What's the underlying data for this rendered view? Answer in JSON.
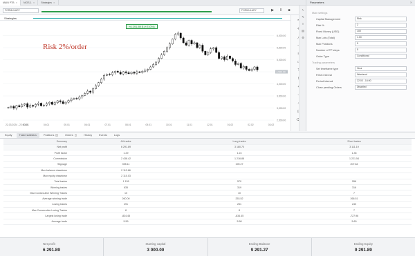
{
  "tabs": [
    {
      "label": "MAIN PTB",
      "active": true
    },
    {
      "label": "NIOS-1",
      "active": false
    },
    {
      "label": "Strategies",
      "active": false
    }
  ],
  "toolbar": {
    "strategy_select": "FORMULARY",
    "right_select": "FORMULARY",
    "progress": 1.0,
    "play_icon": "▶",
    "pause_icon": "‖",
    "stop_icon": "■"
  },
  "chart": {
    "header_label": "Strategies",
    "pnl_badge": "+6 291.89 $ (+210%)",
    "risk_label": "Risk 2%/order"
  },
  "chart_data": {
    "type": "candlestick",
    "x_ticks": [
      "22.03.2024 - 22:00:00",
      "03.01",
      "04.01",
      "05.01",
      "06.01",
      "07.01",
      "08.01",
      "09.01",
      "10.01",
      "11.01",
      "12.01",
      "01.02",
      "02.02",
      "03.02"
    ],
    "y_ticks": [
      "6,000.00",
      "5,500.00",
      "5,000.00",
      "4,500.00",
      "4,000.00",
      "3,500.00",
      "3,000.00",
      "2,500.00"
    ],
    "y_range": [
      2500,
      6500
    ],
    "current_price": "4,500.00",
    "grid": true,
    "close": [
      3020,
      3060,
      2990,
      3100,
      3050,
      3130,
      3180,
      3040,
      3110,
      3070,
      3150,
      3200,
      3090,
      3120,
      3180,
      3240,
      3150,
      3220,
      3300,
      3260,
      3180,
      3240,
      3310,
      3360,
      3400,
      3380,
      3450,
      3520,
      3600,
      3700,
      3650,
      3800,
      3920,
      4050,
      4200,
      4350,
      4400,
      4380,
      4460,
      4520,
      4480,
      4410,
      4500,
      4460,
      4420,
      4480,
      4440,
      4500,
      4470,
      4520,
      4560,
      4600,
      4700,
      4800,
      4900,
      5050,
      5200,
      5350,
      5500,
      5650,
      5850,
      6050,
      6100,
      5900,
      5700,
      5600,
      5800,
      5650,
      5700,
      5500,
      5600,
      5350,
      5200,
      5300,
      5450,
      5500,
      5300,
      5050,
      5120,
      5000,
      5150,
      5050,
      4950,
      4800,
      4850,
      4650,
      4720,
      4600,
      4550,
      4600,
      4700,
      4580
    ]
  },
  "params": {
    "header": "Parameters",
    "section1": "Main settings",
    "section2": "Trading parameters",
    "rows1": [
      {
        "k": "Capital Management",
        "v": "Risk"
      },
      {
        "k": "Risk %",
        "v": "2"
      },
      {
        "k": "Fixed Money (USD)",
        "v": "100"
      },
      {
        "k": "Max Lots (Total)",
        "v": "1.00"
      },
      {
        "k": "Max Positions",
        "v": "5"
      },
      {
        "k": "Number of TP steps",
        "v": "5"
      },
      {
        "k": "Order Type",
        "v": "Conditional"
      }
    ],
    "rows2": [
      {
        "k": "Set timeframe type",
        "v": "Hour"
      },
      {
        "k": "Fetch interval",
        "v": "Weekend"
      },
      {
        "k": "Period interval",
        "v": "22.03 - 16:00"
      },
      {
        "k": "Close pending Orders",
        "v": "Disabled"
      }
    ]
  },
  "bottom_tabs": [
    {
      "label": "Equity",
      "count": ""
    },
    {
      "label": "Trade statistics",
      "count": ""
    },
    {
      "label": "Positions",
      "count": "0"
    },
    {
      "label": "Orders",
      "count": "0"
    },
    {
      "label": "History",
      "count": ""
    },
    {
      "label": "Events",
      "count": ""
    },
    {
      "label": "Logs",
      "count": ""
    }
  ],
  "stats": {
    "columns": [
      "Summary",
      "All trades",
      "Long trades",
      "Short trades"
    ],
    "rows": [
      [
        "Net profit",
        "6 291.89",
        "3 180.70",
        "3 111.19"
      ],
      [
        "Profit factor",
        "1.29",
        "1.24",
        "1.35"
      ],
      [
        "Commission",
        "2 438.42",
        "1 216.88",
        "1 221.54"
      ],
      [
        "Slippage",
        "398.11",
        "190.27",
        "207.84"
      ],
      [
        "Max balance drawdown",
        "2 113.86",
        "",
        ""
      ],
      [
        "Max equity drawdown",
        "2 110.03",
        "",
        ""
      ],
      [
        "Total trades",
        "1 126",
        "570",
        "556"
      ],
      [
        "Winning trades",
        "635",
        "319",
        "316"
      ],
      [
        "Max Consecutive Winning Trades",
        "10",
        "10",
        "7"
      ],
      [
        "Average winning trade",
        "260.00",
        "253.52",
        "266.51"
      ],
      [
        "Losing trades",
        "491",
        "251",
        "240"
      ],
      [
        "Max Consecutive Losing Trades",
        "8",
        "8",
        "7"
      ],
      [
        "Largest losing trade",
        "-834.45",
        "-834.45",
        "-727.96"
      ],
      [
        "Average trade",
        "5.59",
        "5.58",
        "5.60"
      ]
    ]
  },
  "footer": [
    {
      "label": "Net profit",
      "value": "6 291.89"
    },
    {
      "label": "Starting capital",
      "value": "3 000.00"
    },
    {
      "label": "Ending Balance",
      "value": "9 291.27"
    },
    {
      "label": "Ending Equity",
      "value": "9 291.89"
    }
  ]
}
